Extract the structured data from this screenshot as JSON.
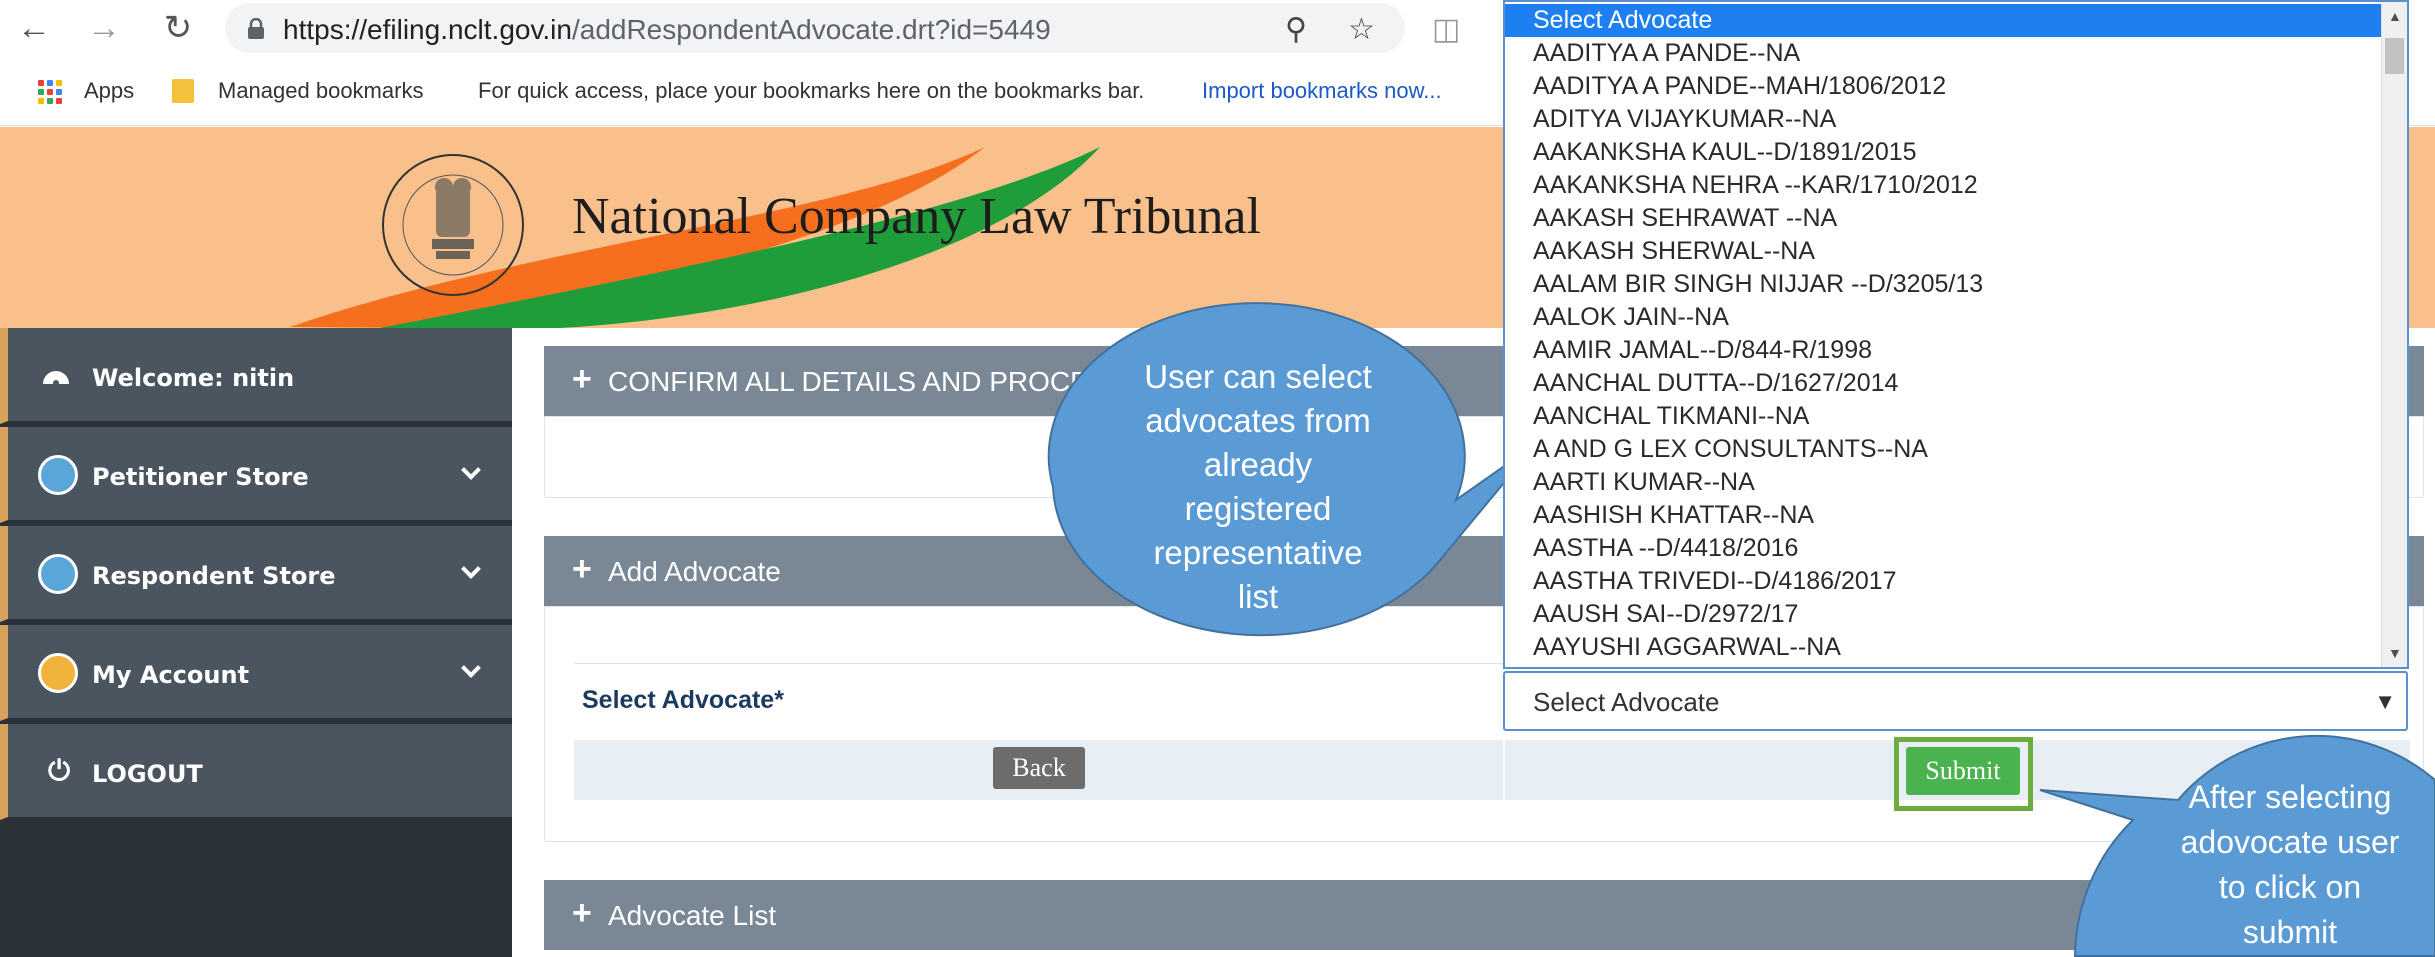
{
  "browser": {
    "url_host": "https://efiling.nclt.gov.in",
    "url_path": "/addRespondentAdvocate.drt?id=5449",
    "bookmarks": {
      "apps": "Apps",
      "managed": "Managed bookmarks",
      "hint": "For quick access, place your bookmarks here on the bookmarks bar.",
      "import_link": "Import bookmarks now..."
    }
  },
  "header": {
    "title": "National Company Law Tribunal",
    "logo_text": "National Company Law Tribunal"
  },
  "sidebar": {
    "welcome": "Welcome: nitin",
    "items": [
      {
        "label": "Petitioner Store"
      },
      {
        "label": "Respondent Store"
      },
      {
        "label": "My Account"
      },
      {
        "label": "LOGOUT"
      }
    ]
  },
  "panels": {
    "confirm": "CONFIRM ALL DETAILS AND PROCE",
    "add_advocate": "Add Advocate",
    "advocate_list": "Advocate List"
  },
  "form": {
    "select_label": "Select Advocate*",
    "select_value": "Select Advocate",
    "back_label": "Back",
    "submit_label": "Submit"
  },
  "dropdown": {
    "options": [
      "Select Advocate",
      "AADITYA A PANDE--NA",
      "AADITYA A PANDE--MAH/1806/2012",
      "ADITYA VIJAYKUMAR--NA",
      "AAKANKSHA KAUL--D/1891/2015",
      "AAKANKSHA NEHRA --KAR/1710/2012",
      "AAKASH SEHRAWAT --NA",
      "AAKASH SHERWAL--NA",
      "AALAM BIR SINGH NIJJAR --D/3205/13",
      "AALOK JAIN--NA",
      "AAMIR JAMAL--D/844-R/1998",
      "AANCHAL DUTTA--D/1627/2014",
      "AANCHAL TIKMANI--NA",
      "A AND G LEX CONSULTANTS--NA",
      "AARTI KUMAR--NA",
      "AASHISH KHATTAR--NA",
      "AASTHA --D/4418/2016",
      "AASTHA TRIVEDI--D/4186/2017",
      "AAUSH SAI--D/2972/17",
      "AAYUSHI AGGARWAL--NA"
    ]
  },
  "callouts": {
    "advocates": [
      "User can select",
      "advocates from",
      "already",
      "registered",
      "representative",
      "list"
    ],
    "submit": [
      "After selecting",
      "adovocate user",
      "to click on",
      "submit"
    ]
  },
  "colors": {
    "header_bg": "#f9c08b",
    "sidebar_bg": "#2a3138",
    "sidebar_item": "#4b5560",
    "panel_head": "#7a8795",
    "callout": "#5b9bd5",
    "submit": "#4ab24e",
    "selected_option": "#1e80f0"
  }
}
